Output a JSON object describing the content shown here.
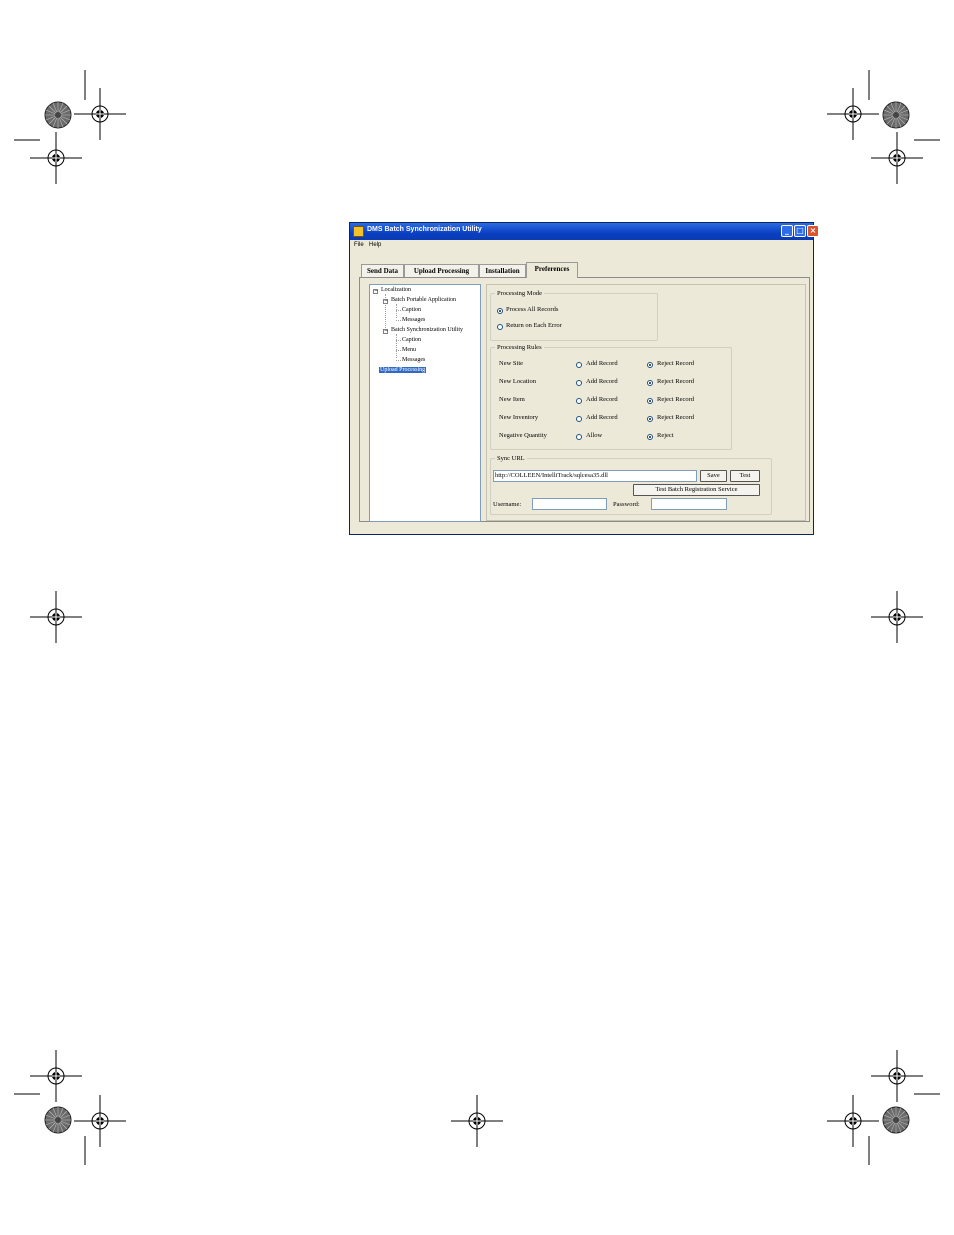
{
  "window": {
    "title": "DMS Batch Synchronization Utility",
    "menu": [
      "File",
      "Help"
    ],
    "controls": {
      "minimize": "_",
      "maximize": "□",
      "close": "×"
    }
  },
  "tabs": [
    "Send Data",
    "Upload Processing",
    "Installation",
    "Preferences"
  ],
  "active_tab": "Preferences",
  "tree": {
    "root": "Localization",
    "expander_collapse": "−",
    "groups": [
      {
        "label": "Batch Portable Application",
        "children": [
          "Caption",
          "Messages"
        ]
      },
      {
        "label": "Batch Synchronization Utility",
        "children": [
          "Caption",
          "Menu",
          "Messages"
        ]
      }
    ],
    "selected": "Upload Processing"
  },
  "processing_mode": {
    "legend": "Processing Mode",
    "options": [
      "Process All Records",
      "Return on Each Error"
    ],
    "selected_index": 0
  },
  "processing_rules": {
    "legend": "Processing Rules",
    "rows": [
      {
        "label": "New Site",
        "option_a": "Add Record",
        "option_b": "Reject Record",
        "selected": "b"
      },
      {
        "label": "New Location",
        "option_a": "Add Record",
        "option_b": "Reject Record",
        "selected": "b"
      },
      {
        "label": "New Item",
        "option_a": "Add Record",
        "option_b": "Reject Record",
        "selected": "b"
      },
      {
        "label": "New Inventory",
        "option_a": "Add Record",
        "option_b": "Reject Record",
        "selected": "b"
      },
      {
        "label": "Negative Quantity",
        "option_a": "Allow",
        "option_b": "Reject",
        "selected": "b"
      }
    ]
  },
  "sync_url": {
    "legend": "Sync URL",
    "url_value": "http://COLLEEN/IntelliTrack/sqlcesa35.dll",
    "save_label": "Save",
    "test_label": "Test",
    "test_batch_label": "Test Batch Registration Service",
    "username_label": "Username:",
    "username_value": "",
    "password_label": "Password:",
    "password_value": ""
  },
  "colors": {
    "titlebar": "#0a3fc2",
    "selection": "#316ac5",
    "window_bg": "#ece9d8"
  },
  "icons": [
    "registration-mark-icon",
    "color-wheel-icon"
  ]
}
